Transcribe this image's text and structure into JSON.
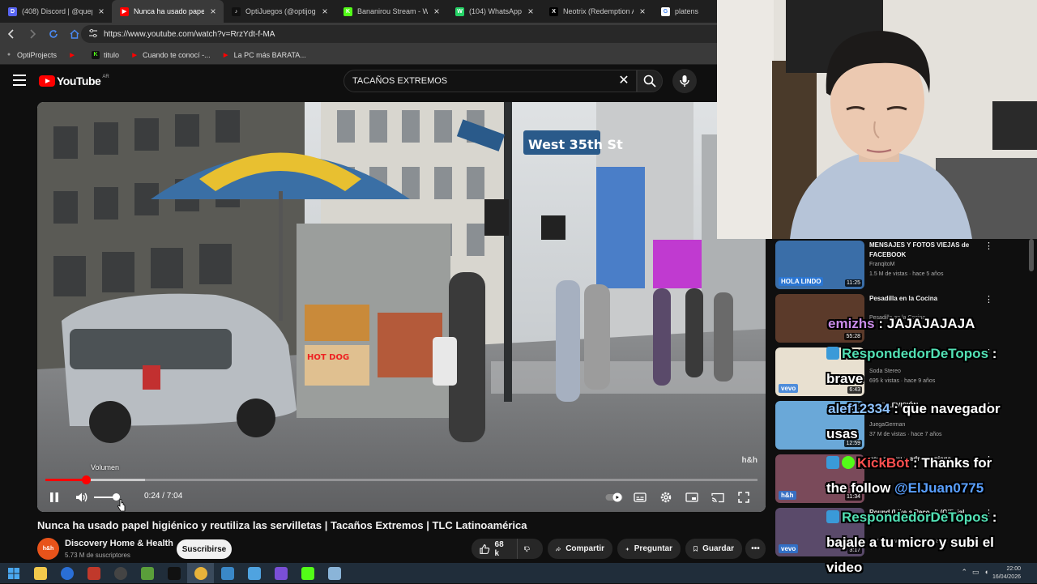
{
  "browser": {
    "tabs": [
      {
        "title": "(408) Discord | @quepcco",
        "color": "#5865f2",
        "glyph": "D"
      },
      {
        "title": "Nunca ha usado papel",
        "color": "#ff0000",
        "glyph": "▶"
      },
      {
        "title": "OptiJuegos (@optijogos)",
        "color": "#111111",
        "glyph": "♪"
      },
      {
        "title": "Bananirou Stream - Watc",
        "color": "#53fc18",
        "glyph": "K"
      },
      {
        "title": "(104) WhatsApp",
        "color": "#25d366",
        "glyph": "W"
      },
      {
        "title": "Neotrix (Redemption Arc",
        "color": "#000000",
        "glyph": "X"
      },
      {
        "title": "platens",
        "color": "#ffffff",
        "glyph": "G"
      }
    ],
    "active_tab": 1,
    "url": "https://www.youtube.com/watch?v=RrzYdt-f-MA",
    "bookmarks": [
      {
        "label": "OptiProjects",
        "color": "#9a9a9a",
        "glyph": "●"
      },
      {
        "label": "",
        "color": "#ff0000",
        "glyph": "▶"
      },
      {
        "label": "titulo",
        "color": "#53fc18",
        "glyph": "K"
      },
      {
        "label": "Cuando te conocí -...",
        "color": "#ff0000",
        "glyph": "▶"
      },
      {
        "label": "La PC más BARATA...",
        "color": "#ff0000",
        "glyph": "▶"
      }
    ]
  },
  "youtube": {
    "logo_text": "YouTube",
    "country_code": "AR",
    "search_value": "TACAÑOS EXTREMOS",
    "player": {
      "current_time": "0:24",
      "duration": "7:04",
      "time_display": "0:24 / 7:04",
      "progress_fraction": 0.057,
      "buffered_fraction": 0.14,
      "volume_fraction": 0.9,
      "volume_tooltip": "Volumen",
      "watermark": "h&h"
    },
    "video_title": "Nunca ha usado papel higiénico y reutiliza las servilletas | Tacaños Extremos | TLC Latinoamérica",
    "channel": {
      "name": "Discovery Home & Health",
      "subscribers": "5.73 M de suscriptores",
      "avatar_text": "h&h"
    },
    "subscribe_label": "Suscribirse",
    "actions": {
      "likes": "68 k",
      "share": "Compartir",
      "ask": "Preguntar",
      "save": "Guardar"
    },
    "recommendations": [
      {
        "title": "MENSAJES Y FOTOS VIEJAS de FACEBOOK",
        "channel": "FranqitoM",
        "meta": "1.5 M de vistas · hace 5 años",
        "duration": "11:25",
        "thumb_color": "#3a6ea8",
        "thumb_text": "HOLA LINDO"
      },
      {
        "title": "Pesadilla en la Cocina",
        "channel": "Pesadilla en la Cocina",
        "meta": "",
        "duration": "55:28",
        "thumb_color": "#5b3a2a",
        "thumb_text": ""
      },
      {
        "title": "Quimeras (Official Audio)",
        "channel": "Soda Stereo",
        "meta": "695 k vistas · hace 9 años",
        "duration": "6:43",
        "thumb_color": "#e8e0d0",
        "thumb_text": "vevo"
      },
      {
        "title": "LA TELEVISIÓN",
        "channel": "JuegaGerman",
        "meta": "37 M de vistas · hace 7 años",
        "duration": "12:59",
        "thumb_color": "#6aa8d8",
        "thumb_text": ""
      },
      {
        "title": "negro y su madre se niega ...",
        "channel": "",
        "meta": "",
        "duration": "11:34",
        "thumb_color": "#7a4a5a",
        "thumb_text": "h&h"
      },
      {
        "title": "Round (Like a Record) (Official...",
        "channel": "",
        "meta": "337 M de vistas · hace 15 años",
        "duration": "3:17",
        "thumb_color": "#5a4a6a",
        "thumb_text": "vevo"
      }
    ]
  },
  "chat": [
    {
      "user": "emizhs",
      "message": "JAJAJAJAJA"
    },
    {
      "user": "RespondedorDeTopos",
      "message": "brave"
    },
    {
      "user": "alef12334",
      "message": "que navegador usas"
    },
    {
      "user": "KickBot",
      "message": "Thanks for the follow",
      "mention": "@ElJuan0775"
    },
    {
      "user": "RespondedorDeTopos",
      "message": "bajale a tu micro y subi el video"
    }
  ],
  "taskbar": {
    "time": "22:00",
    "date": "16/04/2026",
    "apps": [
      {
        "name": "windows-start",
        "color": "#1e90ff"
      },
      {
        "name": "file-explorer",
        "color": "#f2c94c"
      },
      {
        "name": "app-blue-circle",
        "color": "#2a6fd6"
      },
      {
        "name": "app-red",
        "color": "#c0392b"
      },
      {
        "name": "obs",
        "color": "#444444"
      },
      {
        "name": "minecraft",
        "color": "#5a9e3a"
      },
      {
        "name": "terminal",
        "color": "#111111"
      },
      {
        "name": "chrome",
        "color": "#e8b33a"
      },
      {
        "name": "app-folder",
        "color": "#3a88c8"
      },
      {
        "name": "app-photos",
        "color": "#4fa3e0"
      },
      {
        "name": "app-purple",
        "color": "#7a4fd6"
      },
      {
        "name": "kick",
        "color": "#53fc18"
      },
      {
        "name": "notepad",
        "color": "#8ab4d8"
      }
    ]
  }
}
